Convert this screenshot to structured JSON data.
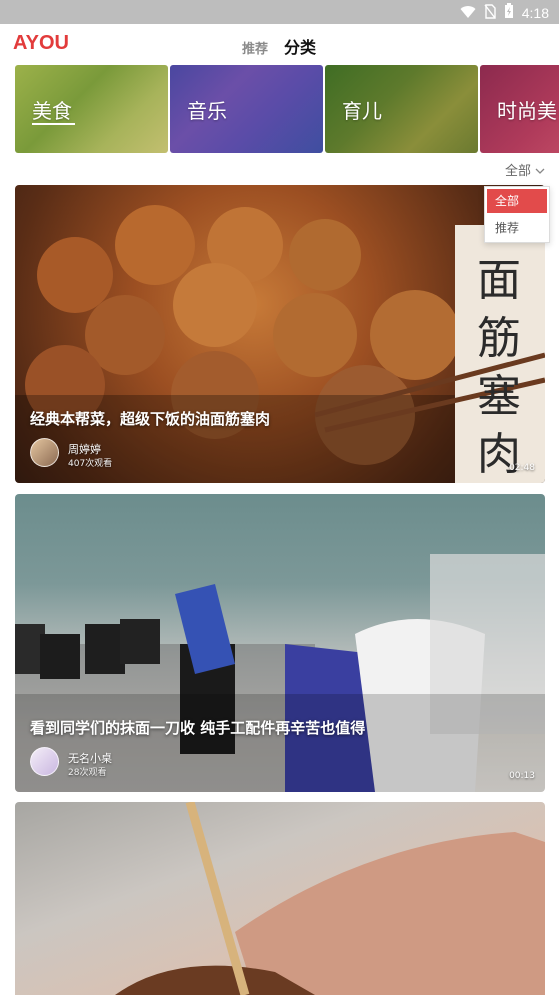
{
  "status_bar": {
    "time": "4:18",
    "icons": [
      "wifi-icon",
      "sim-off-icon",
      "battery-charging-icon"
    ]
  },
  "header": {
    "logo": "AYOU",
    "tabs": [
      {
        "label": "推荐",
        "active": false
      },
      {
        "label": "分类",
        "active": true
      }
    ],
    "accent_color": "#e23b3b"
  },
  "categories": [
    {
      "label": "美食",
      "selected": true
    },
    {
      "label": "音乐",
      "selected": false
    },
    {
      "label": "育儿",
      "selected": false
    },
    {
      "label": "时尚美",
      "selected": false
    }
  ],
  "filter": {
    "selected": "全部",
    "options": [
      "全部",
      "推荐"
    ]
  },
  "videos": [
    {
      "title": "经典本帮菜，超级下饭的油面筋塞肉",
      "author": "周婷婷",
      "views": "407次观看",
      "duration": "02:48",
      "overlay_text": "面筋塞肉"
    },
    {
      "title": "看到同学们的抹面一刀收 纯手工配件再辛苦也值得",
      "author": "无名小桌",
      "views": "28次观看",
      "duration": "00:13"
    },
    {
      "title": "",
      "author": "",
      "views": "",
      "duration": ""
    }
  ]
}
